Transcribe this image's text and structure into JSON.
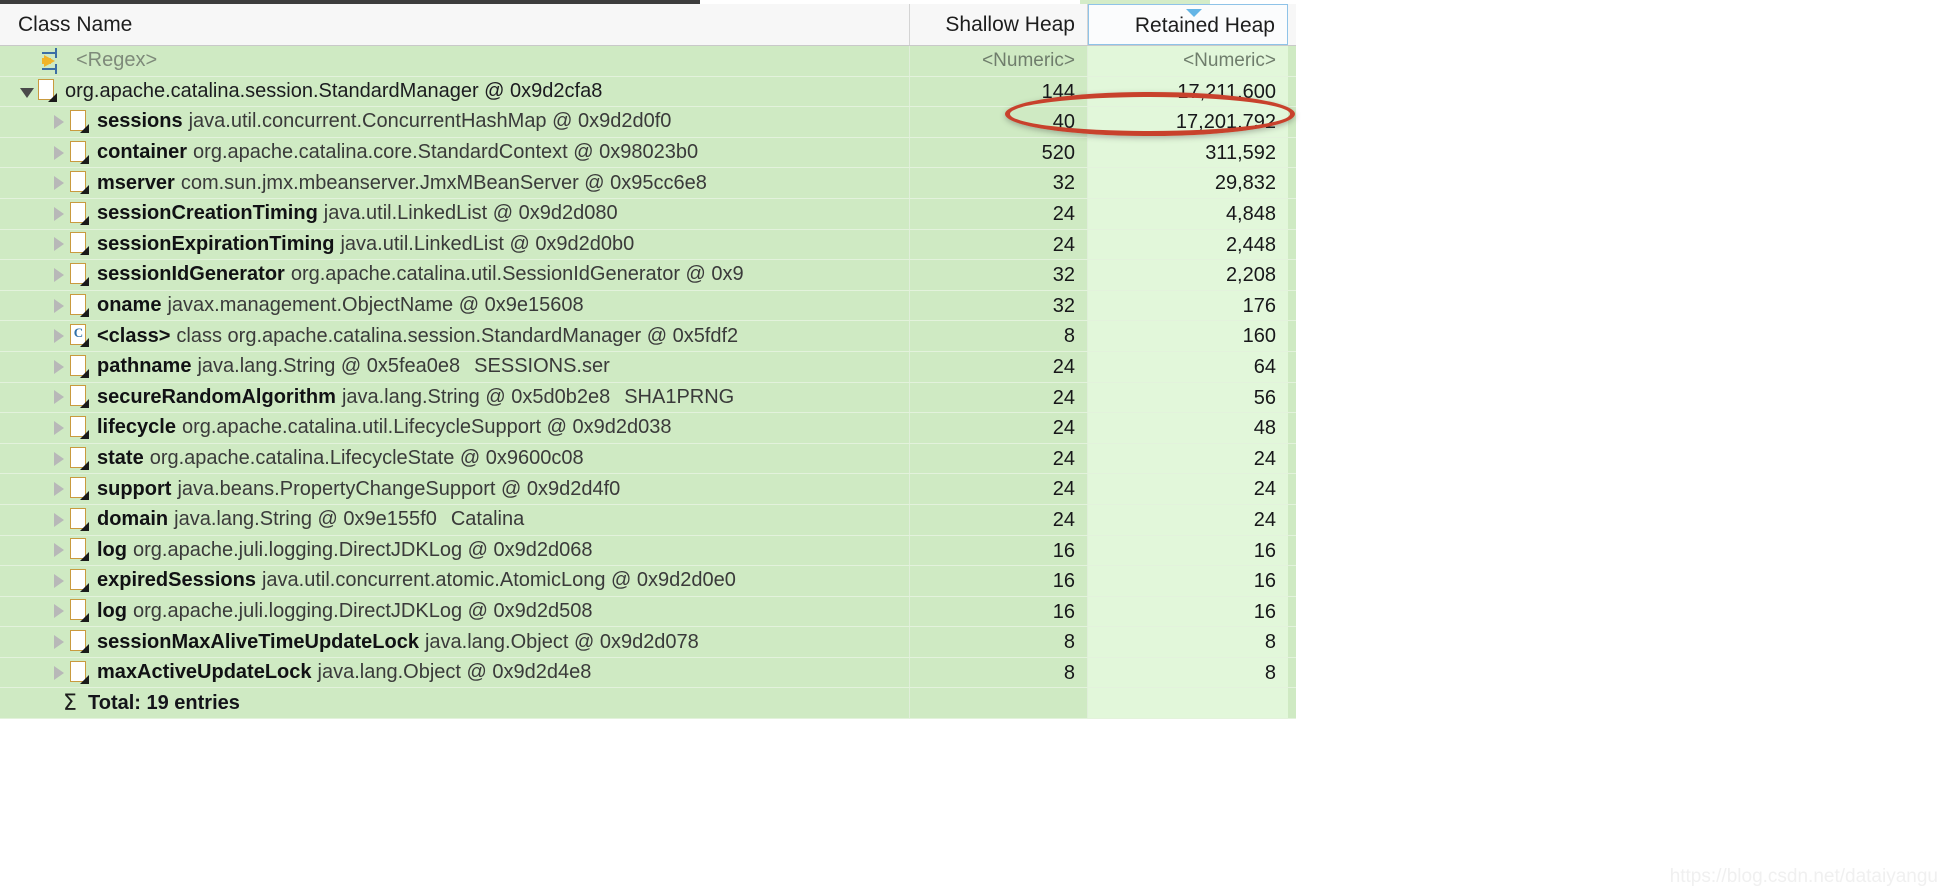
{
  "table": {
    "columns": [
      {
        "key": "class_name",
        "label": "Class Name",
        "align": "left"
      },
      {
        "key": "shallow_heap",
        "label": "Shallow Heap",
        "align": "right"
      },
      {
        "key": "retained_heap",
        "label": "Retained Heap",
        "align": "right",
        "sorted": true,
        "sort_direction": "descending"
      }
    ],
    "filter_row": {
      "icon": "regex-icon",
      "class_name": "<Regex>",
      "shallow_heap": "<Numeric>",
      "retained_heap": "<Numeric>"
    },
    "rows": [
      {
        "icon": "object-icon",
        "twisty": "expanded",
        "depth": 0,
        "field": "",
        "type": "org.apache.catalina.session.StandardManager @ 0x9d2cfa8",
        "extra": "",
        "shallow_heap": "144",
        "retained_heap": "17,211,600",
        "highlighted": false
      },
      {
        "icon": "object-icon",
        "twisty": "collapsed",
        "depth": 1,
        "field": "sessions",
        "type": "java.util.concurrent.ConcurrentHashMap @ 0x9d2d0f0",
        "extra": "",
        "shallow_heap": "40",
        "retained_heap": "17,201,792",
        "highlighted": true
      },
      {
        "icon": "object-icon",
        "twisty": "collapsed",
        "depth": 1,
        "field": "container",
        "type": "org.apache.catalina.core.StandardContext @ 0x98023b0",
        "extra": "",
        "shallow_heap": "520",
        "retained_heap": "311,592",
        "highlighted": false
      },
      {
        "icon": "object-icon",
        "twisty": "collapsed",
        "depth": 1,
        "field": "mserver",
        "type": "com.sun.jmx.mbeanserver.JmxMBeanServer @ 0x95cc6e8",
        "extra": "",
        "shallow_heap": "32",
        "retained_heap": "29,832",
        "highlighted": false
      },
      {
        "icon": "object-icon",
        "twisty": "collapsed",
        "depth": 1,
        "field": "sessionCreationTiming",
        "type": "java.util.LinkedList @ 0x9d2d080",
        "extra": "",
        "shallow_heap": "24",
        "retained_heap": "4,848",
        "highlighted": false
      },
      {
        "icon": "object-icon",
        "twisty": "collapsed",
        "depth": 1,
        "field": "sessionExpirationTiming",
        "type": "java.util.LinkedList @ 0x9d2d0b0",
        "extra": "",
        "shallow_heap": "24",
        "retained_heap": "2,448",
        "highlighted": false
      },
      {
        "icon": "object-icon",
        "twisty": "collapsed",
        "depth": 1,
        "field": "sessionIdGenerator",
        "type": "org.apache.catalina.util.SessionIdGenerator @ 0x9",
        "extra": "",
        "shallow_heap": "32",
        "retained_heap": "2,208",
        "highlighted": false
      },
      {
        "icon": "object-icon",
        "twisty": "collapsed",
        "depth": 1,
        "field": "oname",
        "type": "javax.management.ObjectName @ 0x9e15608",
        "extra": "",
        "shallow_heap": "32",
        "retained_heap": "176",
        "highlighted": false
      },
      {
        "icon": "class-icon",
        "twisty": "collapsed",
        "depth": 1,
        "field": "<class>",
        "type": "class org.apache.catalina.session.StandardManager @ 0x5fdf2",
        "extra": "",
        "shallow_heap": "8",
        "retained_heap": "160",
        "highlighted": false
      },
      {
        "icon": "object-icon",
        "twisty": "collapsed",
        "depth": 1,
        "field": "pathname",
        "type": "java.lang.String @ 0x5fea0e8",
        "extra": "SESSIONS.ser",
        "shallow_heap": "24",
        "retained_heap": "64",
        "highlighted": false
      },
      {
        "icon": "object-icon",
        "twisty": "collapsed",
        "depth": 1,
        "field": "secureRandomAlgorithm",
        "type": "java.lang.String @ 0x5d0b2e8",
        "extra": "SHA1PRNG",
        "shallow_heap": "24",
        "retained_heap": "56",
        "highlighted": false
      },
      {
        "icon": "object-icon",
        "twisty": "collapsed",
        "depth": 1,
        "field": "lifecycle",
        "type": "org.apache.catalina.util.LifecycleSupport @ 0x9d2d038",
        "extra": "",
        "shallow_heap": "24",
        "retained_heap": "48",
        "highlighted": false
      },
      {
        "icon": "object-icon",
        "twisty": "collapsed",
        "depth": 1,
        "field": "state",
        "type": "org.apache.catalina.LifecycleState @ 0x9600c08",
        "extra": "",
        "shallow_heap": "24",
        "retained_heap": "24",
        "highlighted": false
      },
      {
        "icon": "object-icon",
        "twisty": "collapsed",
        "depth": 1,
        "field": "support",
        "type": "java.beans.PropertyChangeSupport @ 0x9d2d4f0",
        "extra": "",
        "shallow_heap": "24",
        "retained_heap": "24",
        "highlighted": false
      },
      {
        "icon": "object-icon",
        "twisty": "collapsed",
        "depth": 1,
        "field": "domain",
        "type": "java.lang.String @ 0x9e155f0",
        "extra": "Catalina",
        "shallow_heap": "24",
        "retained_heap": "24",
        "highlighted": false
      },
      {
        "icon": "object-icon",
        "twisty": "collapsed",
        "depth": 1,
        "field": "log",
        "type": "org.apache.juli.logging.DirectJDKLog @ 0x9d2d068",
        "extra": "",
        "shallow_heap": "16",
        "retained_heap": "16",
        "highlighted": false
      },
      {
        "icon": "object-icon",
        "twisty": "collapsed",
        "depth": 1,
        "field": "expiredSessions",
        "type": "java.util.concurrent.atomic.AtomicLong @ 0x9d2d0e0",
        "extra": "",
        "shallow_heap": "16",
        "retained_heap": "16",
        "highlighted": false
      },
      {
        "icon": "object-icon",
        "twisty": "collapsed",
        "depth": 1,
        "field": "log",
        "type": "org.apache.juli.logging.DirectJDKLog @ 0x9d2d508",
        "extra": "",
        "shallow_heap": "16",
        "retained_heap": "16",
        "highlighted": false
      },
      {
        "icon": "object-icon",
        "twisty": "collapsed",
        "depth": 1,
        "field": "sessionMaxAliveTimeUpdateLock",
        "type": "java.lang.Object @ 0x9d2d078",
        "extra": "",
        "shallow_heap": "8",
        "retained_heap": "8",
        "highlighted": false
      },
      {
        "icon": "object-icon",
        "twisty": "collapsed",
        "depth": 1,
        "field": "maxActiveUpdateLock",
        "type": "java.lang.Object @ 0x9d2d4e8",
        "extra": "",
        "shallow_heap": "8",
        "retained_heap": "8",
        "highlighted": false
      }
    ],
    "total_row": {
      "icon": "sigma-icon",
      "label": "Total: 19 entries",
      "shallow_heap": "",
      "retained_heap": ""
    }
  },
  "annotation": {
    "shape": "ellipse",
    "color": "#c8412c",
    "targets": [
      "40",
      "17,201,792"
    ]
  },
  "watermark": {
    "text": "https://blog.csdn.net/dataiyangu"
  },
  "colors": {
    "row_background": "#cfeac3",
    "retained_column_background": "#e2f7da",
    "header_background": "#f7f7f7",
    "sorted_header_border": "#8fc3e8",
    "annotation": "#c8412c"
  }
}
